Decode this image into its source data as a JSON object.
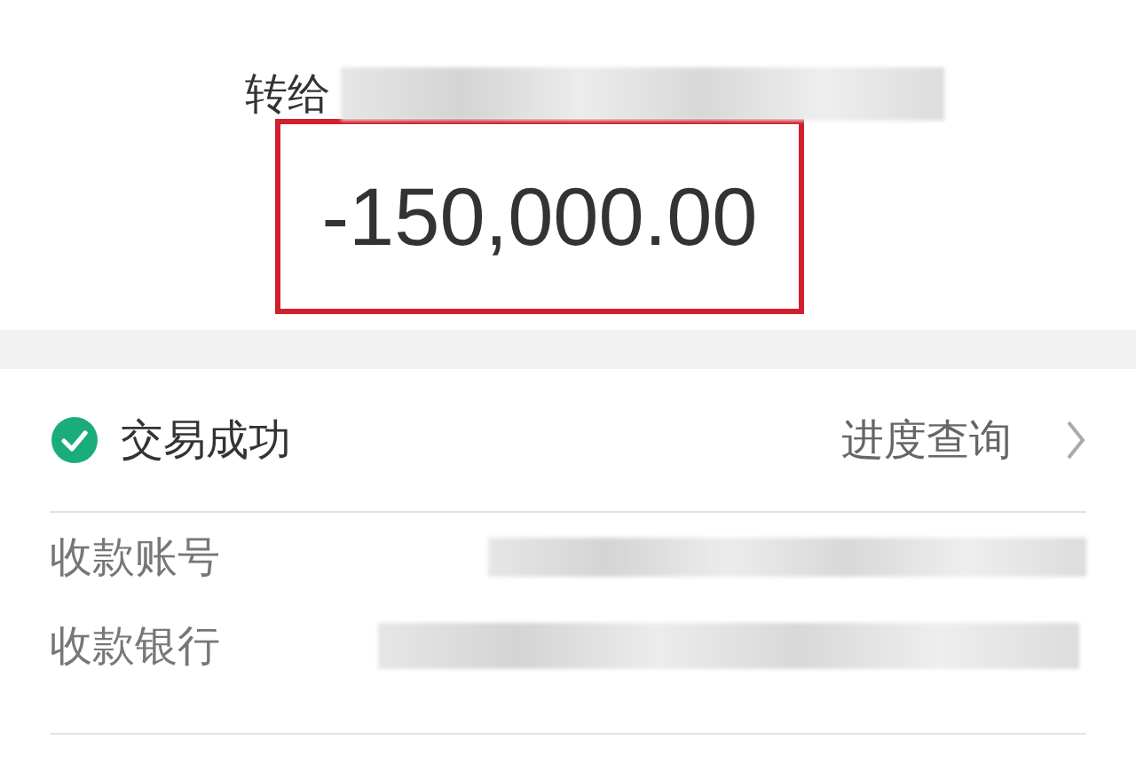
{
  "transfer": {
    "label": "转给",
    "amount": "-150,000.00",
    "highlighted": true
  },
  "status": {
    "text": "交易成功",
    "success": true,
    "link": "进度查询"
  },
  "details": [
    {
      "label": "收款账号"
    },
    {
      "label": "收款银行"
    }
  ]
}
